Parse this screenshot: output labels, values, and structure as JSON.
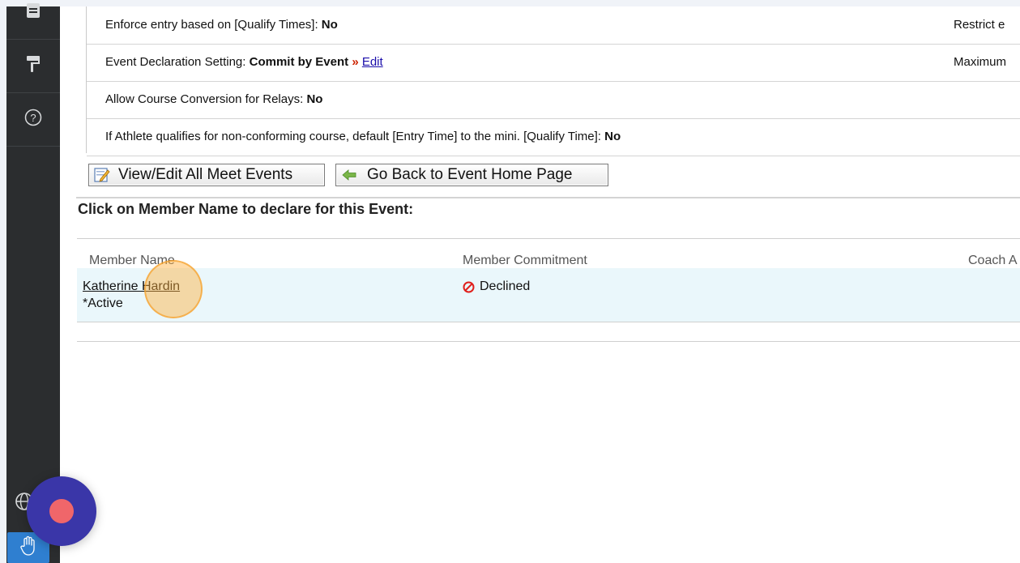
{
  "sidebar": {
    "icons": [
      "document-icon",
      "paint-roller-icon",
      "help-icon",
      "globe-icon",
      "hand-icon"
    ]
  },
  "settings": {
    "rows": [
      {
        "label": "Enforce entry based on [Qualify Times]:",
        "value": "No",
        "right_label": "Restrict e"
      },
      {
        "label": "Event Declaration Setting:",
        "value": "Commit by Event",
        "arrow": "»",
        "link": "Edit",
        "right_label": "Maximum"
      },
      {
        "label": "Allow Course Conversion for Relays:",
        "value": "No"
      },
      {
        "label": "If Athlete qualifies for non-conforming course, default [Entry Time] to the mini. [Qualify Time]:",
        "value": "No"
      }
    ]
  },
  "buttons": {
    "view_edit": "View/Edit All Meet Events",
    "go_back": "Go Back to Event Home Page"
  },
  "section": {
    "heading": "Click on Member Name to declare for this Event:"
  },
  "table": {
    "columns": [
      "Member Name",
      "Member Commitment",
      "Coach A"
    ],
    "rows": [
      {
        "name": "Katherine Hardin",
        "status": "*Active",
        "commitment": "Declined"
      }
    ]
  },
  "colors": {
    "sidebar": "#2b2d2f",
    "row_highlight": "#eaf7fb",
    "declined_icon": "#e0201c",
    "record_button": "#3a36a8",
    "record_dot": "#f0666a",
    "hand_button": "#2f7fd0"
  }
}
